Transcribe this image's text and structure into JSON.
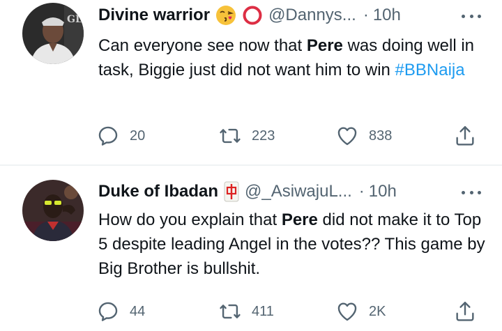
{
  "tweets": [
    {
      "name": "Divine warrior",
      "handle": "@Dannys...",
      "dot": "·",
      "time": "10h",
      "text_before": "Can everyone see now that ",
      "text_bold": "Pere",
      "text_after": " was doing well in task, Biggie just did not want him to win ",
      "hashtag": "#BBNaija",
      "replies": "20",
      "retweets": "223",
      "likes": "838",
      "badge_icons": [
        "face-blowing-kiss-icon",
        "red-circle-icon"
      ]
    },
    {
      "name": "Duke of Ibadan",
      "handle": "@_AsiwajuL...",
      "dot": "·",
      "time": "10h",
      "badge_char": "中",
      "text_before": "How do you explain that ",
      "text_bold": "Pere",
      "text_after": " did not make it to Top 5 despite leading Angel in the votes?? This game by Big Brother is bullshit.",
      "replies": "44",
      "retweets": "411",
      "likes": "2K",
      "badge_icons": [
        "mahjong-red-dragon-icon"
      ]
    }
  ],
  "colors": {
    "text": "#0f1419",
    "secondary": "#536471",
    "link": "#1d9bf0",
    "divider": "#eff3f4"
  }
}
